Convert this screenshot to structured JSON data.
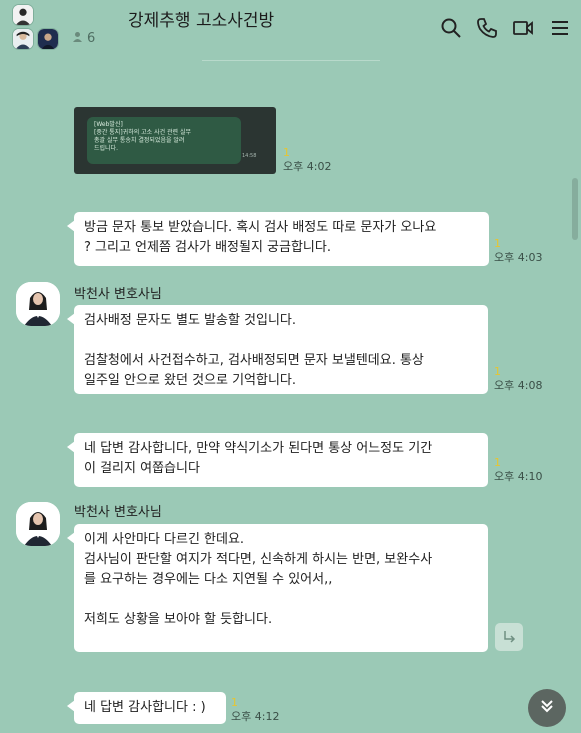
{
  "header": {
    "title": "강제추행 고소사건방",
    "member_count": "6",
    "icons": [
      "search-icon",
      "phone-icon",
      "video-icon",
      "menu-icon"
    ]
  },
  "image_message": {
    "text": "[Web발신]\n[중간 통지]귀하의 고소 사건 관련 실무\n총괄 실무 통송치 결정되었음을 알려\n드립니다.",
    "time_in_image": "14:58",
    "unread": "1",
    "time": "오후 4:02"
  },
  "messages": [
    {
      "text": "방금 문자 통보 받았습니다. 혹시 검사 배정도 따로 문자가 오나요\n? 그리고 언제쯤 검사가 배정될지 궁금합니다.",
      "unread": "1",
      "time": "오후 4:03"
    },
    {
      "sender": "박천사 변호사님",
      "text": "검사배정 문자도 별도 발송할 것입니다.\n\n검찰청에서 사건접수하고, 검사배정되면 문자 보낼텐데요. 통상\n일주일 안으로 왔던 것으로 기억합니다.",
      "unread": "1",
      "time": "오후 4:08"
    },
    {
      "text": "네 답변 감사합니다, 만약 약식기소가 된다면 통상 어느정도 기간\n이 걸리지 여쭙습니다",
      "unread": "1",
      "time": "오후 4:10"
    },
    {
      "sender": "박천사 변호사님",
      "text": "이게 사안마다 다르긴 한데요.\n검사님이 판단할 여지가 적다면, 신속하게 하시는 반면, 보완수사\n를 요구하는 경우에는 다소 지연될 수 있어서,,\n\n저희도 상황을 보아야 할 듯합니다."
    },
    {
      "text": "네 답변 감사합니다 : )",
      "unread": "1",
      "time": "오후 4:12"
    }
  ],
  "colors": {
    "background": "#9bc9b6",
    "bubble": "#ffffff",
    "unread": "#e6c531"
  }
}
